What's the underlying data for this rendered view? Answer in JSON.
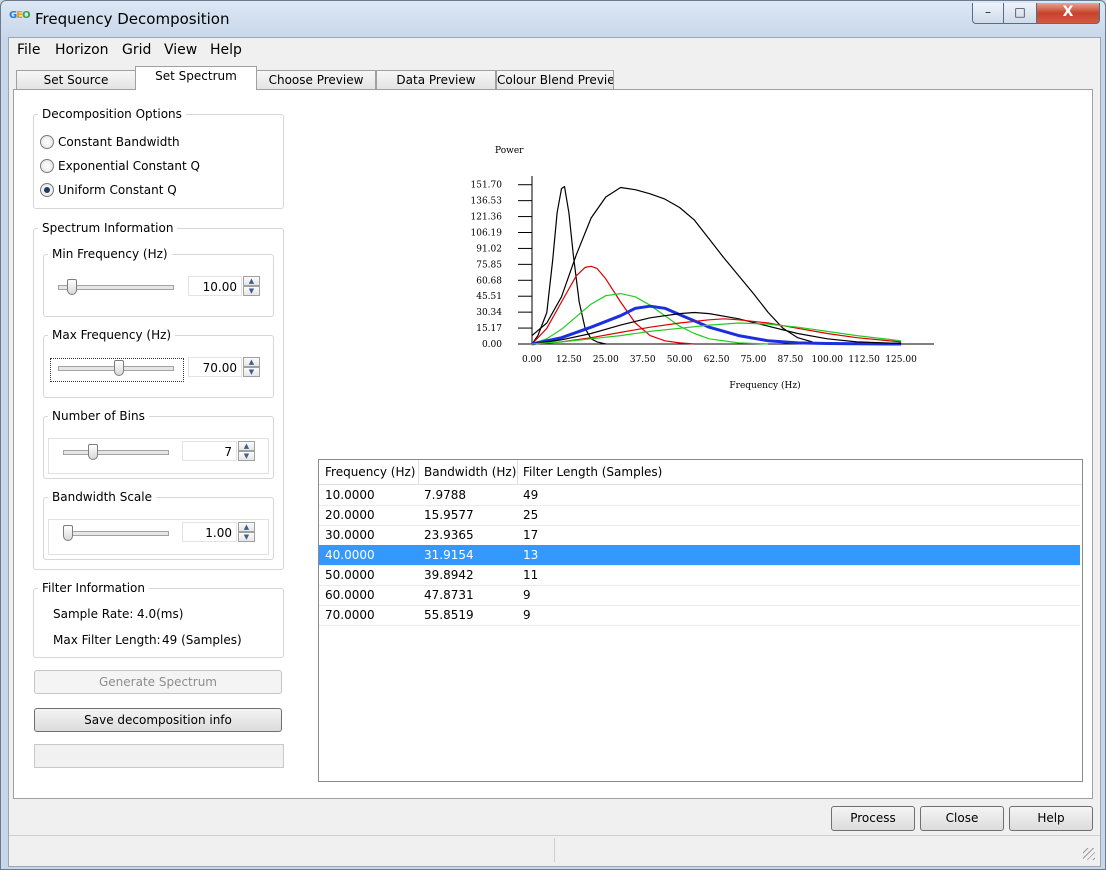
{
  "window": {
    "title": "Frequency Decomposition",
    "icon_text": [
      "G",
      "E",
      "O"
    ],
    "controls": {
      "minimize": "–",
      "maximize": "□",
      "close": "X"
    }
  },
  "menu": [
    "File",
    "Horizon",
    "Grid",
    "View",
    "Help"
  ],
  "tabs": [
    {
      "label": "Set Source",
      "active": false
    },
    {
      "label": "Set Spectrum",
      "active": true
    },
    {
      "label": "Choose Preview",
      "active": false
    },
    {
      "label": "Data Preview",
      "active": false
    },
    {
      "label": "Colour Blend Preview",
      "active": false
    }
  ],
  "decomposition": {
    "title": "Decomposition Options",
    "options": [
      {
        "label": "Constant Bandwidth",
        "selected": false
      },
      {
        "label": "Exponential Constant Q",
        "selected": false
      },
      {
        "label": "Uniform Constant Q",
        "selected": true
      }
    ]
  },
  "spectrum_info": {
    "title": "Spectrum Information",
    "min_freq": {
      "label": "Min Frequency (Hz)",
      "value": "10.00",
      "slider_fraction": 0.09
    },
    "max_freq": {
      "label": "Max Frequency (Hz)",
      "value": "70.00",
      "slider_fraction": 0.54
    },
    "bins": {
      "label": "Number of Bins",
      "value": "7",
      "slider_fraction": 0.27
    },
    "bandwidth_scale": {
      "label": "Bandwidth Scale",
      "value": "1.00",
      "slider_fraction": 0.0
    }
  },
  "filter_info": {
    "title": "Filter Information",
    "sample_rate_label": "Sample Rate:",
    "sample_rate_value": "4.0(ms)",
    "max_len_label": "Max Filter Length:",
    "max_len_value": "49 (Samples)"
  },
  "buttons": {
    "generate": "Generate Spectrum",
    "save": "Save decomposition info",
    "process": "Process",
    "close": "Close",
    "help": "Help"
  },
  "table": {
    "columns": [
      "Frequency (Hz)",
      "Bandwidth (Hz)",
      "Filter Length (Samples)"
    ],
    "rows": [
      [
        "10.0000",
        "7.9788",
        "49"
      ],
      [
        "20.0000",
        "15.9577",
        "25"
      ],
      [
        "30.0000",
        "23.9365",
        "17"
      ],
      [
        "40.0000",
        "31.9154",
        "13"
      ],
      [
        "50.0000",
        "39.8942",
        "11"
      ],
      [
        "60.0000",
        "47.8731",
        "9"
      ],
      [
        "70.0000",
        "55.8519",
        "9"
      ]
    ],
    "selected_row": 3
  },
  "chart_data": {
    "type": "line",
    "title": "",
    "xlabel": "Frequency (Hz)",
    "ylabel": "Power",
    "xlim": [
      0,
      137.5
    ],
    "ylim": [
      0,
      160
    ],
    "x_ticks": [
      "0.00",
      "12.50",
      "25.00",
      "37.50",
      "50.00",
      "62.50",
      "75.00",
      "87.50",
      "100.00",
      "112.50",
      "125.00"
    ],
    "y_ticks": [
      "0.00",
      "15.17",
      "30.34",
      "45.51",
      "60.68",
      "75.85",
      "91.02",
      "106.19",
      "121.36",
      "136.53",
      "151.70"
    ],
    "grid": false,
    "series": [
      {
        "color": "#000000",
        "width": 1.2,
        "x": [
          0,
          2,
          5,
          7,
          8.5,
          10,
          11,
          12.5,
          14,
          16,
          18,
          20,
          22,
          25
        ],
        "y": [
          0,
          8,
          30,
          80,
          125,
          148,
          150,
          125,
          85,
          40,
          15,
          5,
          2,
          0
        ]
      },
      {
        "color": "#000000",
        "width": 1.2,
        "x": [
          0,
          5,
          10,
          15,
          20,
          25,
          30,
          35,
          40,
          45,
          50,
          55,
          60,
          65,
          70,
          75,
          80,
          85,
          90,
          95
        ],
        "y": [
          8,
          20,
          45,
          85,
          120,
          140,
          149,
          147,
          143,
          138,
          130,
          118,
          100,
          82,
          65,
          48,
          30,
          15,
          6,
          2
        ]
      },
      {
        "color": "#dd0000",
        "width": 1.2,
        "x": [
          0,
          5,
          10,
          15,
          18,
          20,
          22,
          25,
          30,
          35,
          40,
          45,
          50,
          55
        ],
        "y": [
          0,
          15,
          40,
          65,
          73,
          74,
          72,
          62,
          40,
          20,
          8,
          3,
          1,
          0
        ]
      },
      {
        "color": "#22cc22",
        "width": 1.2,
        "x": [
          0,
          5,
          10,
          15,
          20,
          25,
          30,
          35,
          40,
          45,
          50,
          55,
          60,
          70,
          80
        ],
        "y": [
          0,
          5,
          14,
          26,
          38,
          46,
          48,
          45,
          37,
          27,
          17,
          10,
          5,
          1,
          0
        ]
      },
      {
        "color": "#1a2fe0",
        "width": 3,
        "x": [
          0,
          10,
          20,
          30,
          35,
          40,
          45,
          50,
          55,
          60,
          70,
          80,
          90,
          100,
          110,
          120,
          125
        ],
        "y": [
          0,
          6,
          16,
          27,
          34,
          36,
          34,
          28,
          22,
          16,
          8,
          3,
          1,
          0.5,
          0.2,
          0,
          0
        ]
      },
      {
        "color": "#000000",
        "width": 1.2,
        "x": [
          0,
          10,
          20,
          30,
          40,
          50,
          55,
          60,
          70,
          80,
          90,
          100,
          110,
          125
        ],
        "y": [
          0,
          4,
          10,
          18,
          25,
          29,
          30,
          29,
          24,
          17,
          10,
          5,
          2,
          0.5
        ]
      },
      {
        "color": "#dd0000",
        "width": 1.2,
        "x": [
          0,
          10,
          20,
          30,
          40,
          50,
          60,
          65,
          70,
          80,
          90,
          100,
          110,
          125
        ],
        "y": [
          0,
          2,
          6,
          11,
          16,
          20,
          23,
          24,
          23,
          20,
          15,
          10,
          6,
          2
        ]
      },
      {
        "color": "#22cc22",
        "width": 1.2,
        "x": [
          0,
          10,
          20,
          30,
          40,
          50,
          60,
          70,
          80,
          90,
          100,
          110,
          125
        ],
        "y": [
          0,
          2,
          5,
          8,
          12,
          15,
          18,
          20,
          19,
          16,
          12,
          8,
          3
        ]
      }
    ]
  }
}
